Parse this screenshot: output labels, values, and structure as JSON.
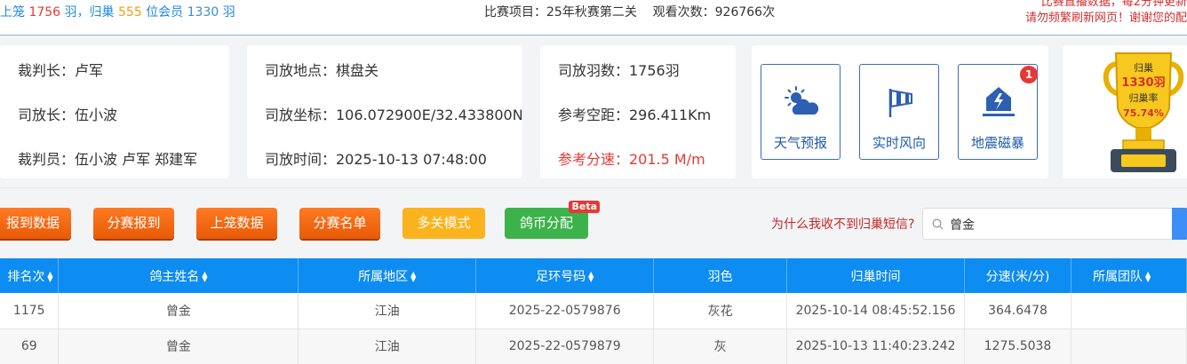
{
  "top": {
    "stat_prefix": "上笼",
    "total": "1756",
    "unit1": "羽，归巢",
    "returned": "555",
    "unit2": "位会员",
    "members": "1330",
    "unit3": "羽",
    "match_label": "比赛项目：",
    "match_value": "25年秋赛第二关",
    "views_label": "观看次数：",
    "views_value": "926766次",
    "notice_line1": "比赛直播数据，每2分钟更新",
    "notice_line2": "请勿频繁刷新网页！谢谢您的配"
  },
  "info": {
    "card1": [
      "裁判长：卢军",
      "司放长：伍小波",
      "裁判员：伍小波 卢军 郑建军"
    ],
    "card2": [
      "司放地点：棋盘关",
      "司放坐标：106.072900E/32.433800N",
      "司放时间：2025-10-13 07:48:00"
    ],
    "card3": [
      "司放羽数：1756羽",
      "参考空距：296.411Km",
      "参考分速：201.5 M/m"
    ]
  },
  "tools": [
    {
      "label": "天气预报",
      "icon": "weather-icon"
    },
    {
      "label": "实时风向",
      "icon": "windsock-icon"
    },
    {
      "label": "地震磁暴",
      "icon": "earthquake-icon",
      "badge": "1"
    }
  ],
  "trophy": {
    "title": "归巢",
    "count": "1330羽",
    "rate_label": "归巢率",
    "rate": "75.74%"
  },
  "buttons": [
    "报到数据",
    "分赛报到",
    "上笼数据",
    "分赛名单",
    "多关模式",
    "鸽币分配"
  ],
  "beta_label": "Beta",
  "why_link": "为什么我收不到归巢短信?",
  "search": {
    "value": "曾金"
  },
  "table": {
    "headers": [
      "排名次",
      "鸽主姓名",
      "所属地区",
      "足环号码",
      "羽色",
      "归巢时间",
      "分速(米/分)",
      "所属团队"
    ],
    "rows": [
      [
        "1175",
        "曾金",
        "江油",
        "2025-22-0579876",
        "灰花",
        "2025-10-14 08:45:52.156",
        "364.6478",
        ""
      ],
      [
        "69",
        "曾金",
        "江油",
        "2025-22-0579879",
        "灰",
        "2025-10-13 11:40:23.242",
        "1275.5038",
        ""
      ]
    ]
  },
  "colors": {
    "accent": "#0d8cf2",
    "orange_button": "#f06a12",
    "yellow_button": "#fbb31d",
    "green_button": "#3cb34a",
    "alert_red": "#e53935"
  }
}
